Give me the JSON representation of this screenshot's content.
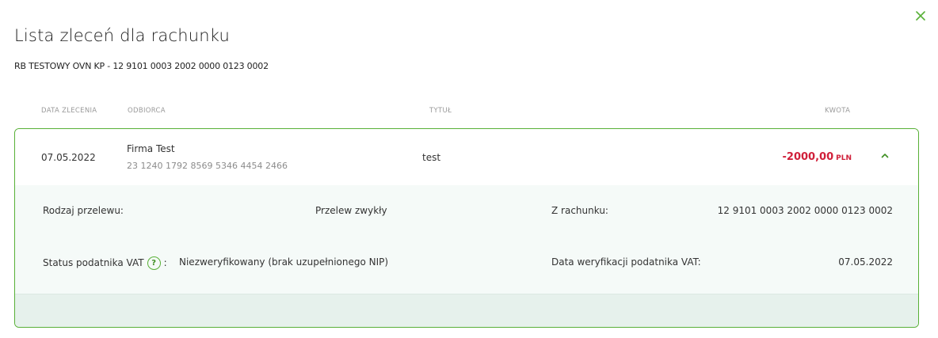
{
  "dialog": {
    "title": "Lista zleceń dla rachunku",
    "subtitle": "RB TESTOWY OVN KP - 12 9101 0003 2002 0000 0123 0002",
    "close_icon": "close-icon",
    "accent_color": "#58b037",
    "amount_color": "#d0203a"
  },
  "table": {
    "headers": {
      "date": "DATA ZLECENIA",
      "recipient": "ODBIORCA",
      "title": "TYTUŁ",
      "amount": "KWOTA"
    },
    "rows": [
      {
        "date": "07.05.2022",
        "recipient_name": "Firma Test",
        "recipient_account": "23 1240 1792 8569 5346 4454 2466",
        "title": "test",
        "amount": "-2000,00",
        "currency": "PLN",
        "expanded": true,
        "toggle_icon": "chevron-up-icon",
        "details": {
          "transfer_type_label": "Rodzaj przelewu:",
          "transfer_type_value": "Przelew zwykły",
          "from_account_label": "Z rachunku:",
          "from_account_value": "12 9101 0003 2002 0000 0123 0002",
          "vat_status_label": "Status podatnika VAT",
          "vat_help_icon": "question-icon",
          "vat_status_colon": ":",
          "vat_status_value": "Niezweryfikowany (brak uzupełnionego NIP)",
          "vat_check_date_label": "Data weryfikacji podatnika VAT:",
          "vat_check_date_value": "07.05.2022"
        }
      }
    ]
  }
}
